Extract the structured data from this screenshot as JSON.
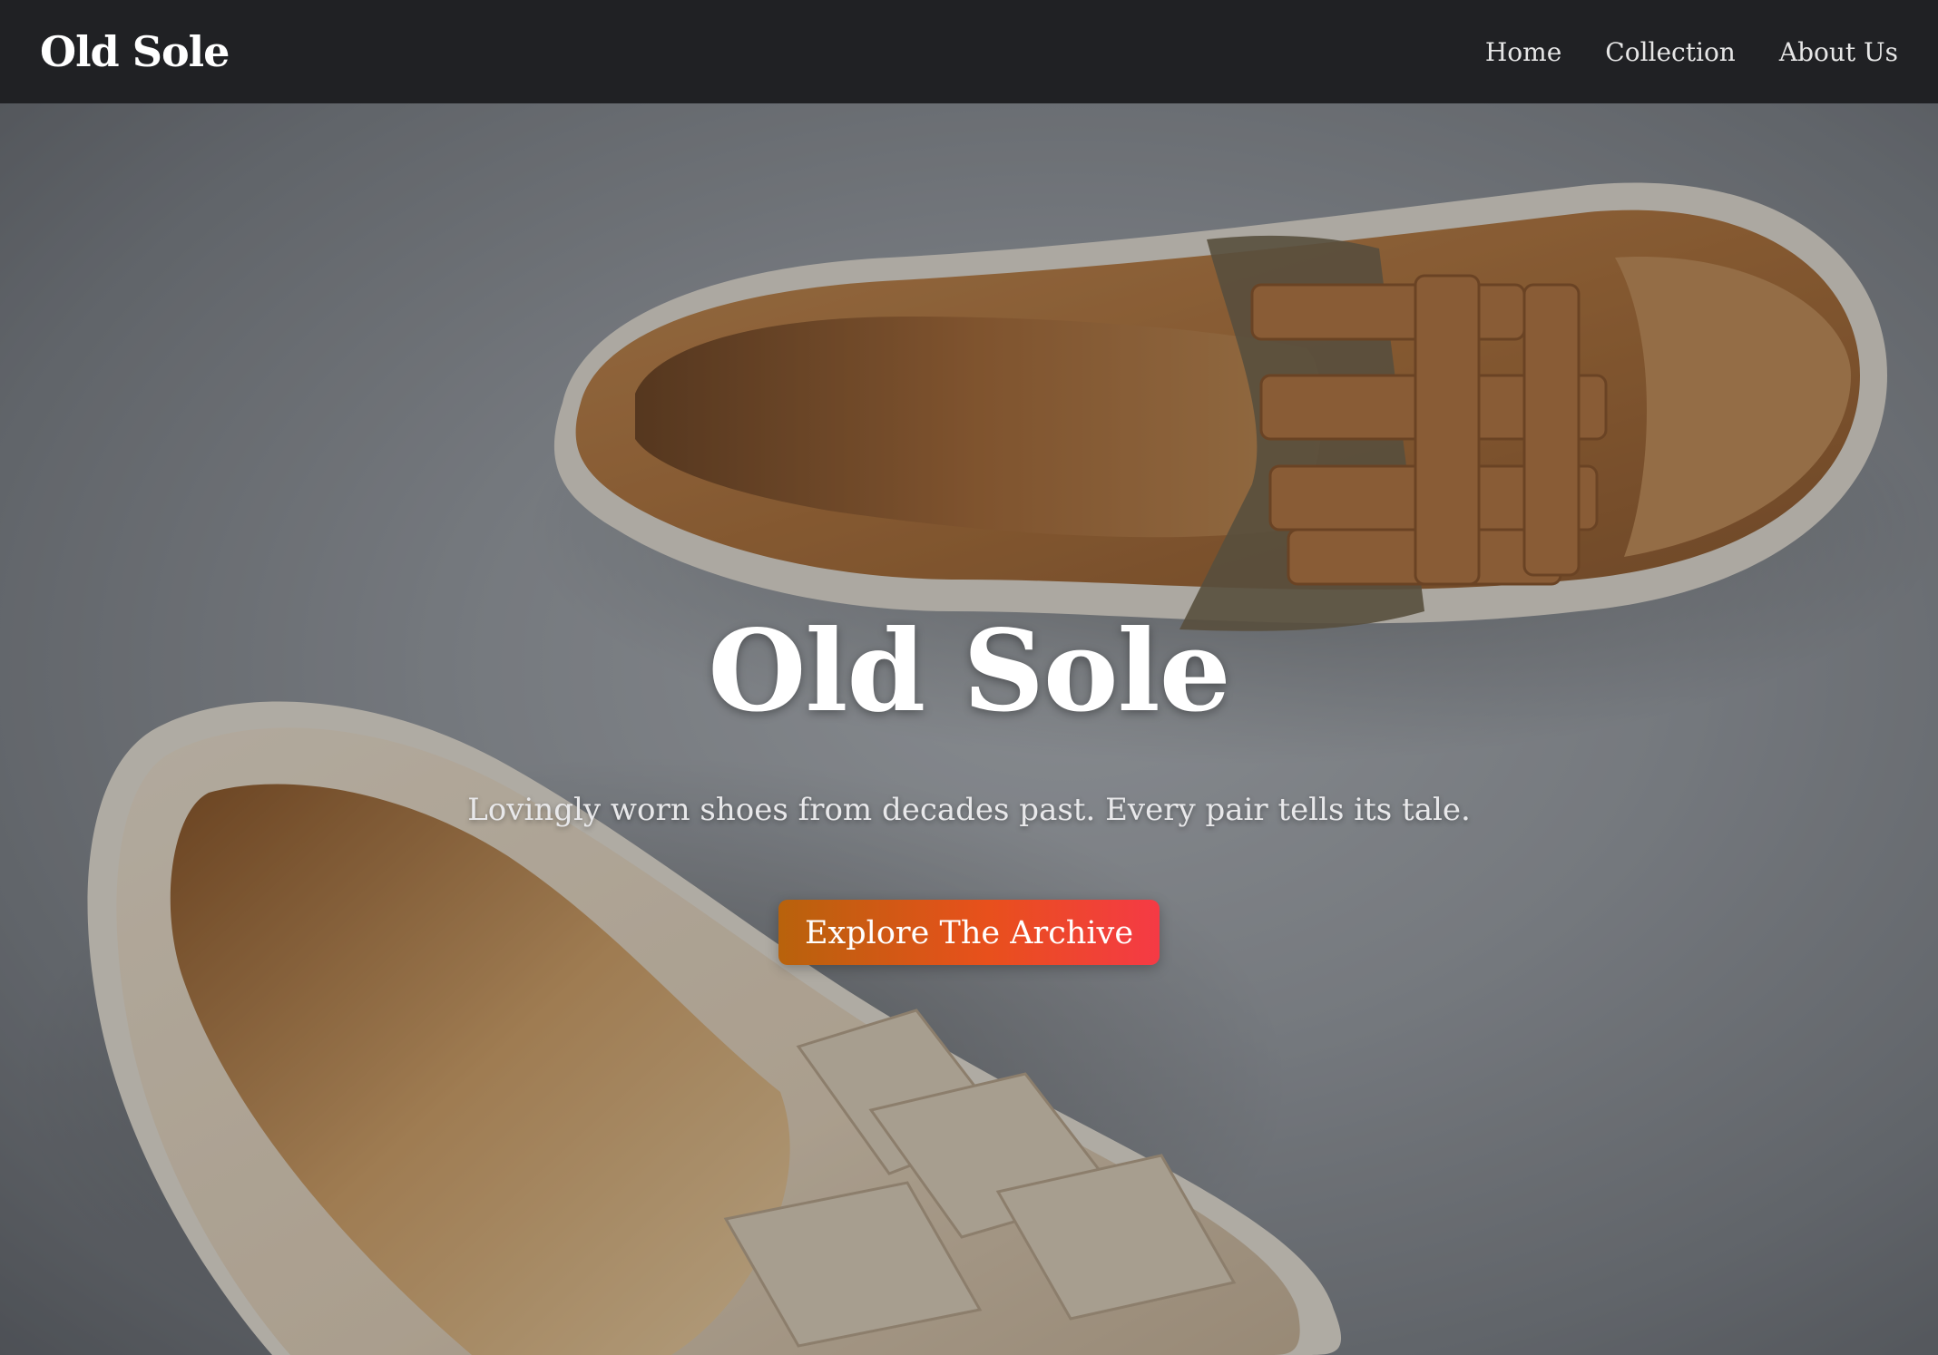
{
  "nav": {
    "brand": "Old Sole",
    "links": [
      "Home",
      "Collection",
      "About Us"
    ]
  },
  "hero": {
    "title": "Old Sole",
    "subtitle": "Lovingly worn shoes from decades past. Every pair tells its tale.",
    "cta_label": "Explore The Archive",
    "image_subject": "two leather woven loafers (tan and cream) on grey background"
  },
  "colors": {
    "navbar_bg": "#202124",
    "cta_gradient_start": "#b8620c",
    "cta_gradient_mid": "#e8501c",
    "cta_gradient_end": "#f53a45",
    "text_primary": "#ffffff"
  }
}
